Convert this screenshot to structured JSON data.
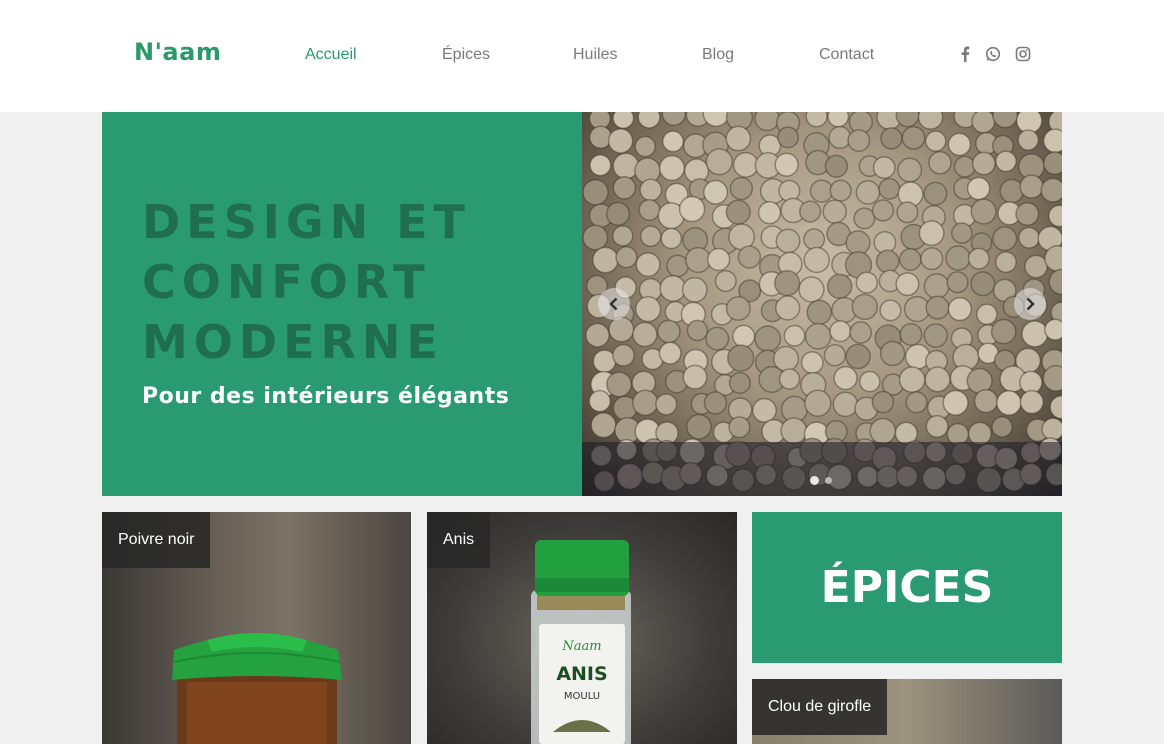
{
  "header": {
    "logo": "N'aam",
    "nav": [
      {
        "label": "Accueil",
        "active": true
      },
      {
        "label": "Épices",
        "active": false
      },
      {
        "label": "Huiles",
        "active": false
      },
      {
        "label": "Blog",
        "active": false
      },
      {
        "label": "Contact",
        "active": false
      }
    ],
    "social": [
      "facebook-icon",
      "whatsapp-icon",
      "instagram-icon"
    ]
  },
  "hero": {
    "title": "DESIGN ET CONFORT MODERNE",
    "subtitle": "Pour des intérieurs élégants",
    "dots": 2,
    "active_dot": 0
  },
  "products": [
    {
      "label": "Poivre noir"
    },
    {
      "label": "Anis",
      "jar_brand": "Naam",
      "jar_name": "ANIS",
      "jar_sub": "MOULU"
    },
    {
      "label": "Clou de girofle"
    }
  ],
  "category": {
    "title": "ÉPICES"
  },
  "colors": {
    "brand": "#2a9a72",
    "text_muted": "#7a7a7a",
    "jar_cap": "#22a040"
  }
}
